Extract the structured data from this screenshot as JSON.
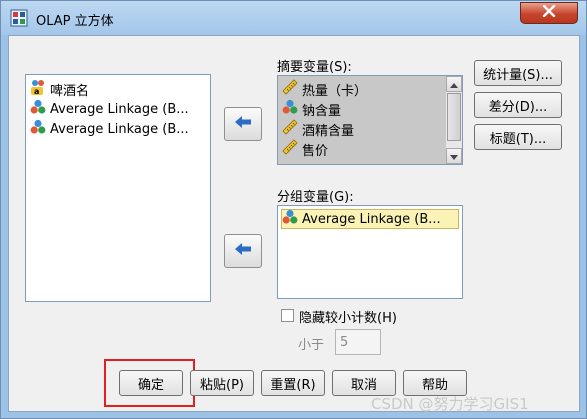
{
  "window": {
    "title": "OLAP 立方体"
  },
  "source_list": {
    "items": [
      {
        "label": "啤酒名",
        "icon": "nominal-string-variable-icon"
      },
      {
        "label": "Average Linkage (B...",
        "icon": "nominal-cluster-variable-icon"
      },
      {
        "label": "Average Linkage (B...",
        "icon": "nominal-cluster-variable-icon"
      }
    ]
  },
  "summary": {
    "label": "摘要变量(S):",
    "items": [
      {
        "label": "热量（卡）",
        "icon": "scale-ruler-icon"
      },
      {
        "label": "钠含量",
        "icon": "nominal-cluster-variable-icon"
      },
      {
        "label": "酒精含量",
        "icon": "scale-ruler-icon"
      },
      {
        "label": "售价",
        "icon": "scale-ruler-icon"
      }
    ]
  },
  "grouping": {
    "label": "分组变量(G):",
    "items": [
      {
        "label": "Average Linkage (B...",
        "icon": "nominal-cluster-variable-icon"
      }
    ]
  },
  "side_buttons": {
    "statistics": "统计量(S)...",
    "differences": "差分(D)...",
    "title": "标题(T)..."
  },
  "options": {
    "hide_small_counts_label": "隐藏较小计数(H)",
    "hide_small_counts_checked": false,
    "less_than_label": "小于",
    "less_than_value": "5"
  },
  "bottom_buttons": {
    "ok": "确定",
    "paste": "粘贴(P)",
    "reset": "重置(R)",
    "cancel": "取消",
    "help": "帮助"
  },
  "watermark": "CSDN @努力学习GIS1",
  "colors": {
    "titlebar": "#a3c6e9",
    "arrow_blue": "#2b6cc4",
    "selection": "#fbf2b6",
    "default_highlight": "#e02020"
  }
}
